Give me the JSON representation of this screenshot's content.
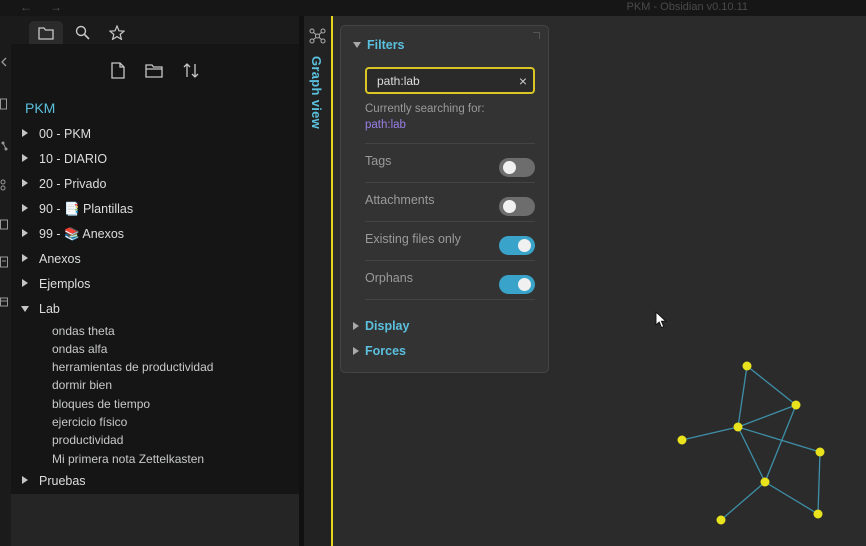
{
  "titlebar": {
    "back": "←",
    "forward": "→",
    "title": "PKM - Obsidian v0.10.11"
  },
  "explorer": {
    "tabs": [
      {
        "name": "files-tab",
        "icon": "folder-icon",
        "active": true
      },
      {
        "name": "search-tab",
        "icon": "search-icon",
        "active": false
      },
      {
        "name": "starred-tab",
        "icon": "star-icon",
        "active": false
      }
    ],
    "nav_buttons": [
      {
        "name": "new-note-button",
        "icon": "new-file-icon"
      },
      {
        "name": "new-folder-button",
        "icon": "new-folder-icon"
      },
      {
        "name": "sort-button",
        "icon": "sort-icon"
      }
    ],
    "vault_name": "PKM",
    "folders": [
      {
        "label": "00 - PKM",
        "open": false
      },
      {
        "label": "10 - DIARIO",
        "open": false
      },
      {
        "label": "20 - Privado",
        "open": false
      },
      {
        "label": "90 - 📑 Plantillas",
        "open": false
      },
      {
        "label": "99 - 📚 Anexos",
        "open": false
      },
      {
        "label": "Anexos",
        "open": false
      },
      {
        "label": "Ejemplos",
        "open": false
      },
      {
        "label": "Lab",
        "open": true
      },
      {
        "label": "Pruebas",
        "open": false
      }
    ],
    "lab_files": [
      "ondas theta",
      "ondas alfa",
      "herramientas de productividad",
      "dormir bien",
      "bloques de tiempo",
      "ejercicio físico",
      "productividad",
      "Mi primera nota Zettelkasten"
    ]
  },
  "graph": {
    "view_title": "Graph view",
    "colors": {
      "accent": "#5bc0de",
      "node": "#e8e31d",
      "edge": "#3e8fa8",
      "query": "#9b7fe6"
    },
    "filters": {
      "header": "Filters",
      "search_value": "path:lab",
      "clear": "×",
      "currently_searching_label": "Currently searching for:",
      "currently_searching_value": "path:lab",
      "options": [
        {
          "label": "Tags",
          "enabled": false
        },
        {
          "label": "Attachments",
          "enabled": false
        },
        {
          "label": "Existing files only",
          "enabled": true
        },
        {
          "label": "Orphans",
          "enabled": true
        }
      ]
    },
    "display_header": "Display",
    "forces_header": "Forces"
  }
}
